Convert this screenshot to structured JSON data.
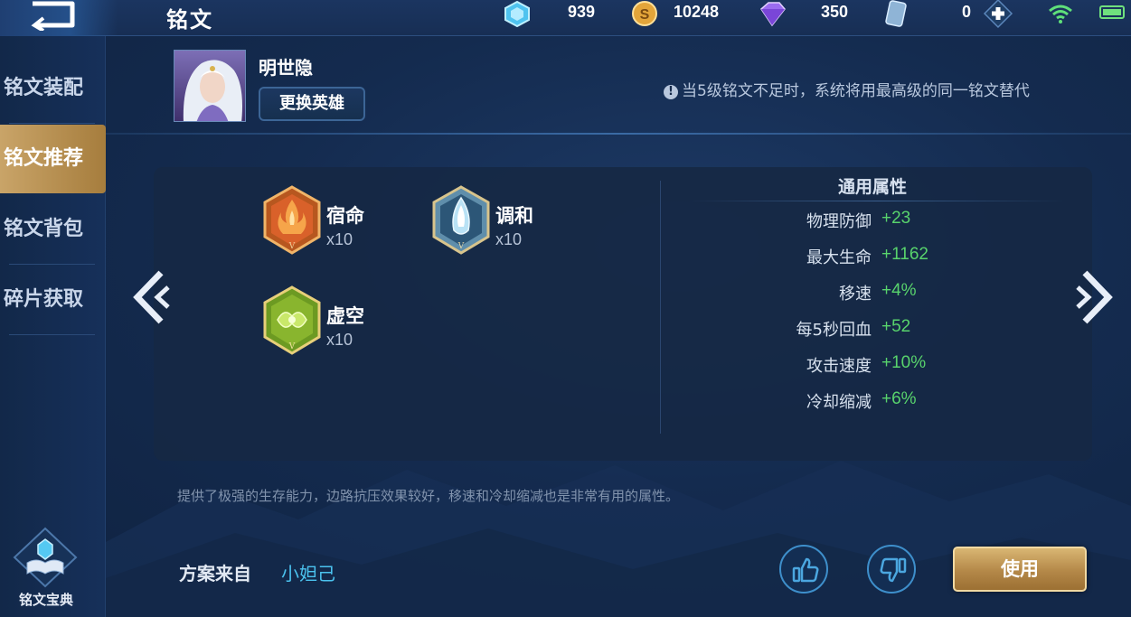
{
  "header": {
    "title": "铭文",
    "currencies": [
      {
        "name": "diamond",
        "value": "939"
      },
      {
        "name": "gold-coin",
        "value": "10248"
      },
      {
        "name": "crystal",
        "value": "350"
      },
      {
        "name": "card",
        "value": "0"
      }
    ]
  },
  "sidebar": {
    "items": [
      {
        "label": "铭文装配",
        "active": false
      },
      {
        "label": "铭文推荐",
        "active": true
      },
      {
        "label": "铭文背包",
        "active": false
      },
      {
        "label": "碎片获取",
        "active": false
      }
    ],
    "codex_label": "铭文宝典"
  },
  "hero": {
    "name": "明世隐",
    "change_button": "更换英雄"
  },
  "notice": {
    "icon": "!",
    "text": "当5级铭文不足时，系统将用最高级的同一铭文替代"
  },
  "runes": [
    {
      "name": "宿命",
      "count": "x10",
      "color": "#d45a26",
      "icon": "fate-rune-icon"
    },
    {
      "name": "调和",
      "count": "x10",
      "color": "#7fb3d1",
      "icon": "harmony-rune-icon"
    },
    {
      "name": "虚空",
      "count": "x10",
      "color": "#7cb830",
      "icon": "void-rune-icon"
    }
  ],
  "attributes": {
    "title": "通用属性",
    "rows": [
      {
        "label": "物理防御",
        "value": "+23"
      },
      {
        "label": "最大生命",
        "value": "+1162"
      },
      {
        "label": "移速",
        "value": "+4%"
      },
      {
        "label": "每5秒回血",
        "value": "+52"
      },
      {
        "label": "攻击速度",
        "value": "+10%"
      },
      {
        "label": "冷却缩减",
        "value": "+6%"
      }
    ]
  },
  "description": "提供了极强的生存能力，边路抗压效果较好，移速和冷却缩减也是非常有用的属性。",
  "source": {
    "label": "方案来自",
    "author": "小妲己"
  },
  "actions": {
    "use_label": "使用"
  },
  "colors": {
    "accent_gold": "#c9a468",
    "positive_green": "#58d36c",
    "author_blue": "#4bc2ee"
  }
}
